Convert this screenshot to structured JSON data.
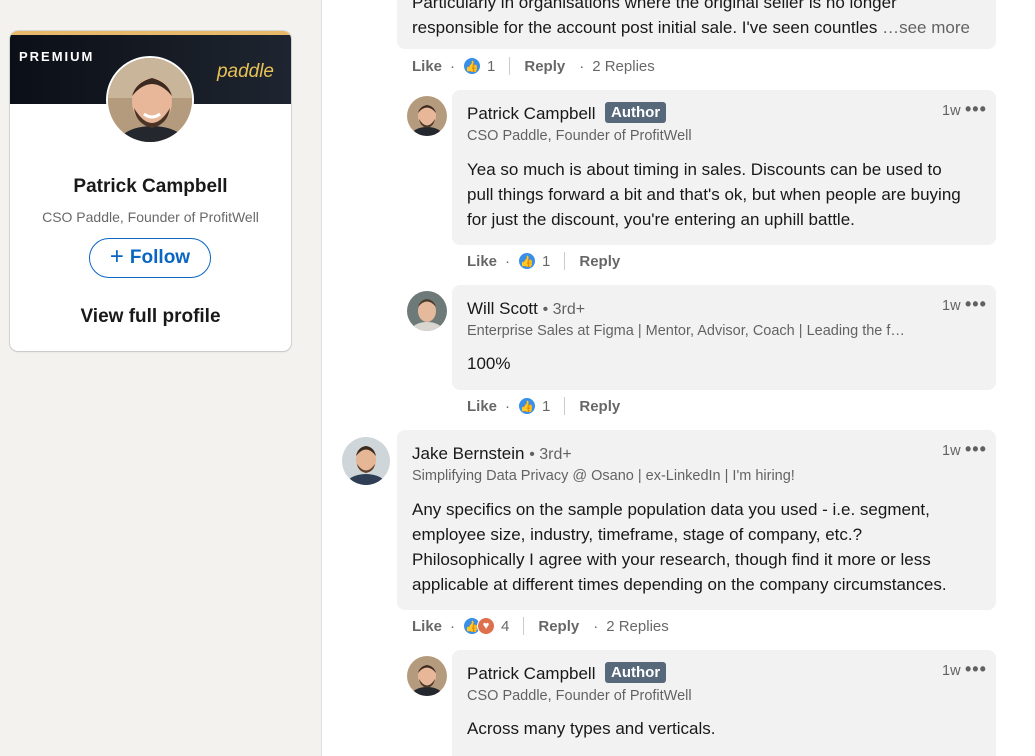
{
  "profile_card": {
    "premium_label": "PREMIUM",
    "brand_logo_text": "paddle",
    "name": "Patrick Campbell",
    "headline": "CSO Paddle, Founder of ProfitWell",
    "follow_label": "Follow",
    "view_profile_label": "View full profile"
  },
  "comments": [
    {
      "body": "Particularly in organisations where the original seller is no longer responsible for the account post initial sale. I've seen countles",
      "see_more": "…see more",
      "like": "Like",
      "reaction_count": "1",
      "reply": "Reply",
      "replies": "2 Replies"
    },
    {
      "name": "Patrick Campbell",
      "badge": "Author",
      "headline": "CSO Paddle, Founder of ProfitWell",
      "time": "1w",
      "body": "Yea so much is about timing in sales. Discounts can be used to pull things forward a bit and that's ok, but when people are buying for just the discount, you're entering an uphill battle.",
      "like": "Like",
      "reaction_count": "1",
      "reply": "Reply"
    },
    {
      "name": "Will Scott",
      "degree": "• 3rd+",
      "headline": "Enterprise Sales at Figma | Mentor, Advisor, Coach | Leading the f…",
      "time": "1w",
      "body": "100%",
      "like": "Like",
      "reaction_count": "1",
      "reply": "Reply"
    },
    {
      "name": "Jake Bernstein",
      "degree": "• 3rd+",
      "headline": "Simplifying Data Privacy @ Osano | ex-LinkedIn | I'm hiring!",
      "time": "1w",
      "body": "Any specifics on the sample population data you used - i.e. segment, employee size, industry, timeframe, stage of company, etc.? Philosophically I agree with your research, though find it more or less applicable at different times depending on the company circumstances.",
      "like": "Like",
      "reaction_count": "4",
      "reply": "Reply",
      "replies": "2 Replies"
    },
    {
      "name": "Patrick Campbell",
      "badge": "Author",
      "headline": "CSO Paddle, Founder of ProfitWell",
      "time": "1w",
      "body": "Across many types and verticals."
    }
  ],
  "icons": {
    "more": "more-icon",
    "like_reaction": "like-reaction-icon",
    "love_reaction": "love-reaction-icon"
  },
  "colors": {
    "accent": "#0a66c2",
    "author_badge": "#56687a",
    "like": "#378fe9",
    "love": "#df704d"
  }
}
